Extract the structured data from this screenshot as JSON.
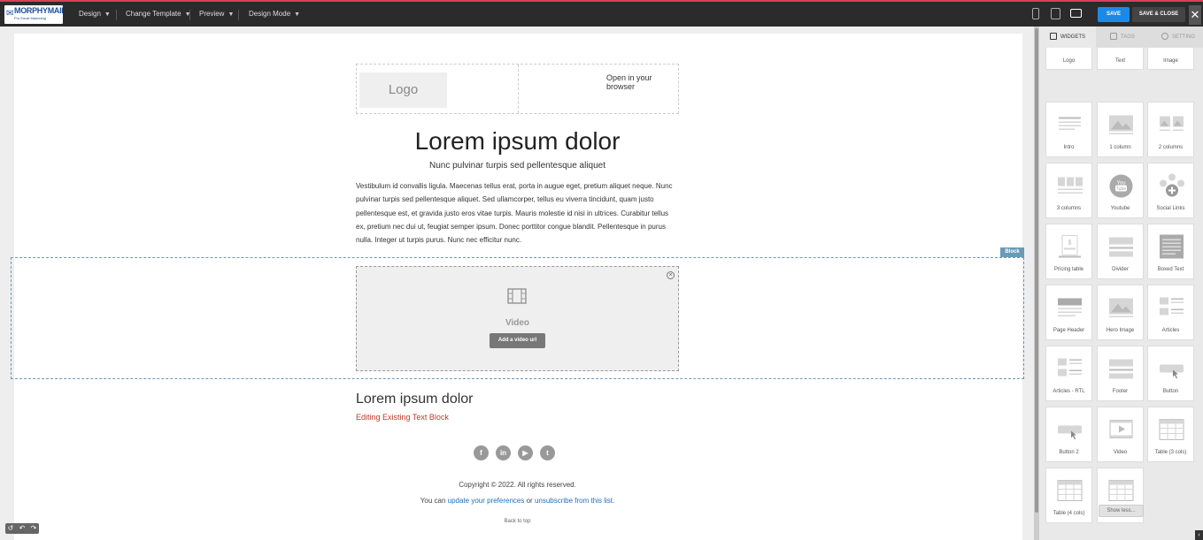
{
  "app": {
    "logo_name": "MORPHYMAIL",
    "logo_tagline": "Pro Email Marketing"
  },
  "topbar": {
    "menus": [
      {
        "label": "Design"
      },
      {
        "label": "Change Template"
      },
      {
        "label": "Preview"
      },
      {
        "label": "Design Mode"
      }
    ],
    "devices": [
      "mobile-icon",
      "tablet-icon",
      "desktop-icon"
    ],
    "save_label": "SAVE",
    "save_close_label": "SAVE & CLOSE",
    "close_glyph": "✕"
  },
  "email": {
    "logo_placeholder": "Logo",
    "open_in_browser": "Open in your browser",
    "title": "Lorem ipsum dolor",
    "subtitle": "Nunc pulvinar turpis sed pellentesque aliquet",
    "paragraph": "Vestibulum id convallis ligula. Maecenas tellus erat, porta in augue eget, pretium aliquet neque. Nunc pulvinar turpis sed pellentesque aliquet. Sed ullamcorper, tellus eu viverra tincidunt, quam justo pellentesque est, et gravida justo eros vitae turpis. Mauris molestie id nisi in ultrices. Curabitur tellus ex, pretium nec dui ut, feugiat semper ipsum. Donec porttitor congue blandit. Pellentesque in purus nulla. Integer ut turpis purus. Nunc nec efficitur nunc.",
    "block_tag": "Block",
    "video_label": "Video",
    "video_button": "Add a video url",
    "heading2": "Lorem ipsum dolor",
    "editing_text": "Editing Existing Text Block",
    "social": [
      {
        "name": "facebook-icon",
        "glyph": "f"
      },
      {
        "name": "linkedin-icon",
        "glyph": "in"
      },
      {
        "name": "youtube-icon",
        "glyph": "▶"
      },
      {
        "name": "twitter-icon",
        "glyph": "t"
      }
    ],
    "copyright": "Copyright © 2022. All rights reserved.",
    "pref_prefix": "You can ",
    "pref_link": "update your preferences",
    "pref_middle": " or ",
    "unsub_link": "unsubscribe from this list",
    "pref_suffix": ".",
    "back_to_top": "Back to top"
  },
  "panel": {
    "tabs": [
      {
        "label": "WIDGETS",
        "active": true
      },
      {
        "label": "TAGS",
        "active": false
      },
      {
        "label": "SETTING",
        "active": false
      }
    ],
    "widgets": [
      "Logo",
      "Text",
      "Image",
      "Intro",
      "1 column",
      "2 columns",
      "3 columns",
      "Youtube",
      "Social Links",
      "Pricing table",
      "Divider",
      "Boxed Text",
      "Page Header",
      "Hero Image",
      "Articles",
      "Articles - RTL",
      "Footer",
      "Button",
      "Button 2",
      "Video",
      "Table (3 cols)",
      "Table (4 cols)",
      "Table (5 cols)"
    ],
    "show_less": "Show less..."
  },
  "colors": {
    "accent": "#1b8ae6",
    "topbar": "#2b2b2b",
    "block_frame": "#6b9ab8",
    "edit_text": "#c0392b"
  }
}
